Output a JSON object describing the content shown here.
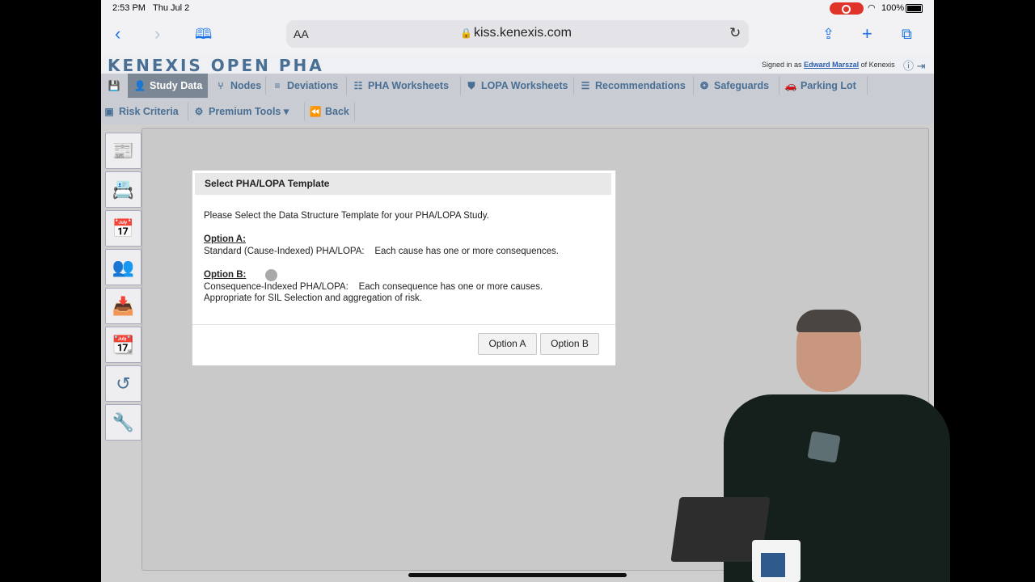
{
  "status": {
    "time": "2:53 PM",
    "date": "Thu Jul 2",
    "battery": "100%"
  },
  "browser": {
    "aa": "AA",
    "url": "kiss.kenexis.com"
  },
  "app": {
    "logo": "KENEXIS OPEN PHA",
    "signed_prefix": "Signed in as",
    "user": "Edward Marszal",
    "org": "of Kenexis"
  },
  "nav": {
    "row1": [
      {
        "label": "Study Data"
      },
      {
        "label": "Nodes"
      },
      {
        "label": "Deviations"
      },
      {
        "label": "PHA Worksheets"
      },
      {
        "label": "LOPA Worksheets"
      },
      {
        "label": "Recommendations"
      },
      {
        "label": "Safeguards"
      },
      {
        "label": "Parking Lot"
      }
    ],
    "row2": [
      {
        "label": "Risk Criteria"
      },
      {
        "label": "Premium Tools"
      },
      {
        "label": "Back"
      }
    ]
  },
  "dialog": {
    "title": "Select PHA/LOPA Template",
    "intro": "Please Select the Data Structure Template for your PHA/LOPA Study.",
    "option_a_heading": "Option A:",
    "option_a_text": "Standard (Cause-Indexed) PHA/LOPA:    Each cause has one or more consequences.",
    "option_b_heading": "Option B:",
    "option_b_text1": "Consequence-Indexed PHA/LOPA:    Each consequence has one or more causes.",
    "option_b_text2": "Appropriate for SIL Selection and aggregation of risk.",
    "button_a": "Option A",
    "button_b": "Option B"
  },
  "icons": [
    "back-icon",
    "forward-icon",
    "bookmarks-icon",
    "lock-icon",
    "reload-icon",
    "share-icon",
    "add-tab-icon",
    "tabs-icon",
    "help-icon",
    "logout-icon",
    "save-icon"
  ],
  "colors": {
    "accent": "#4a6f94",
    "nav_bg": "#c9ccd2",
    "active_tab": "#7b8794",
    "ios_blue": "#1a73e8",
    "record": "#e0342b"
  }
}
